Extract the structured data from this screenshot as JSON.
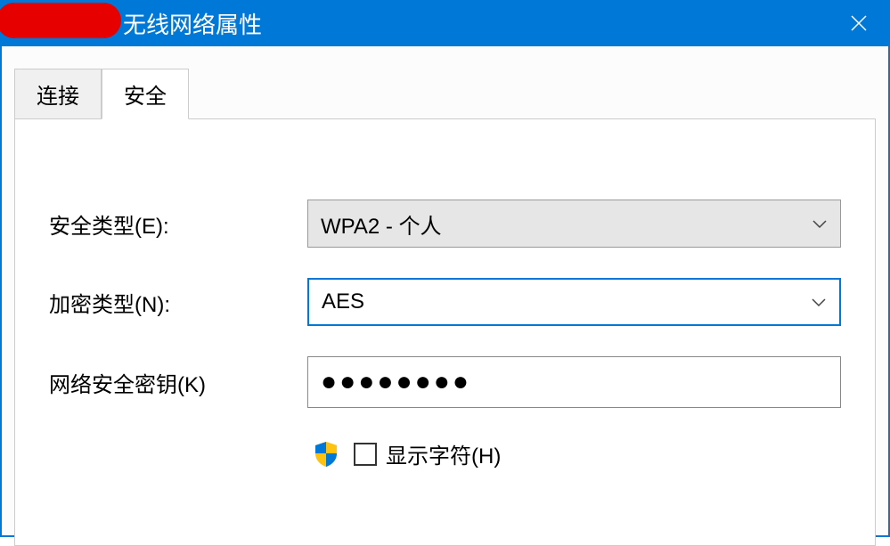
{
  "titlebar": {
    "title": "无线网络属性"
  },
  "tabs": {
    "connection": "连接",
    "security": "安全"
  },
  "form": {
    "security_type_label": "安全类型(E):",
    "security_type_value": "WPA2 - 个人",
    "encryption_type_label": "加密类型(N):",
    "encryption_type_value": "AES",
    "network_key_label": "网络安全密钥(K)",
    "network_key_value": "●●●●●●●●",
    "show_chars_label": "显示字符(H)"
  }
}
